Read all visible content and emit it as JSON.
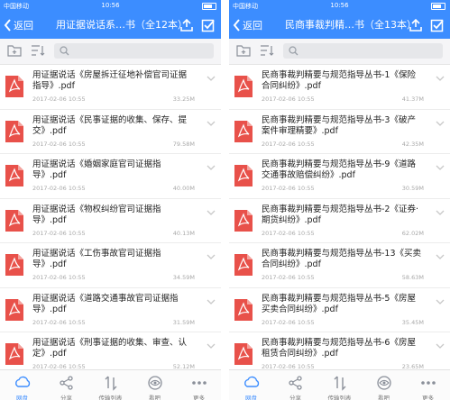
{
  "colors": {
    "brand": "#3c8dff",
    "pdf": "#e8514a"
  },
  "screens": [
    {
      "status": {
        "carrier": "中国移动",
        "time": "10:56"
      },
      "nav": {
        "back_label": "返回",
        "title": "用证据说话系…书（全12本）"
      },
      "files": [
        {
          "name": "用证据说话《房屋拆迁征地补偿官司证据指导》.pdf",
          "date": "2017-02-06 10:55",
          "size": "33.25M"
        },
        {
          "name": "用证据说话《民事证据的收集、保存、提交》.pdf",
          "date": "2017-02-06 10:55",
          "size": "79.58M"
        },
        {
          "name": "用证据说话《婚姻家庭官司证据指导》.pdf",
          "date": "2017-02-06 10:55",
          "size": "40.00M"
        },
        {
          "name": "用证据说话《物权纠纷官司证据指导》.pdf",
          "date": "2017-02-06 10:55",
          "size": "40.13M"
        },
        {
          "name": "用证据说话《工伤事故官司证据指导》.pdf",
          "date": "2017-02-06 10:55",
          "size": "34.59M"
        },
        {
          "name": "用证据说话《道路交通事故官司证据指导》.pdf",
          "date": "2017-02-06 10:55",
          "size": "31.59M"
        },
        {
          "name": "用证据说话《刑事证据的收集、审查、认定》.pdf",
          "date": "2017-02-06 10:55",
          "size": "52.12M"
        }
      ]
    },
    {
      "status": {
        "carrier": "中国移动",
        "time": "10:56"
      },
      "nav": {
        "back_label": "返回",
        "title": "民商事裁判精…书（全13本）"
      },
      "files": [
        {
          "name": "民商事裁判精要与规范指导丛书-1《保险合同纠纷》.pdf",
          "date": "2017-02-06 10:55",
          "size": "41.37M"
        },
        {
          "name": "民商事裁判精要与规范指导丛书-3《破产案件审理精要》.pdf",
          "date": "2017-02-06 10:55",
          "size": "42.35M"
        },
        {
          "name": "民商事裁判精要与规范指导丛书-9《道路交通事故赔偿纠纷》.pdf",
          "date": "2017-02-06 10:55",
          "size": "30.59M"
        },
        {
          "name": "民商事裁判精要与规范指导丛书-2《证券·期货纠纷》.pdf",
          "date": "2017-02-06 10:55",
          "size": "62.02M"
        },
        {
          "name": "民商事裁判精要与规范指导丛书-13《买卖合同纠纷》.pdf",
          "date": "2017-02-06 10:55",
          "size": "58.63M"
        },
        {
          "name": "民商事裁判精要与规范指导丛书-5《房屋买卖合同纠纷》.pdf",
          "date": "2017-02-06 10:55",
          "size": "35.45M"
        },
        {
          "name": "民商事裁判精要与规范指导丛书-6《房屋租赁合同纠纷》.pdf",
          "date": "2017-02-06 10:55",
          "size": "23.65M"
        }
      ]
    }
  ],
  "tabbar": [
    {
      "label": "网盘",
      "icon": "cloud-icon",
      "active": true
    },
    {
      "label": "分享",
      "icon": "share-icon",
      "active": false
    },
    {
      "label": "传输列表",
      "icon": "transfer-icon",
      "active": false
    },
    {
      "label": "看吧",
      "icon": "eye-icon",
      "active": false
    },
    {
      "label": "更多",
      "icon": "more-icon",
      "active": false
    }
  ]
}
